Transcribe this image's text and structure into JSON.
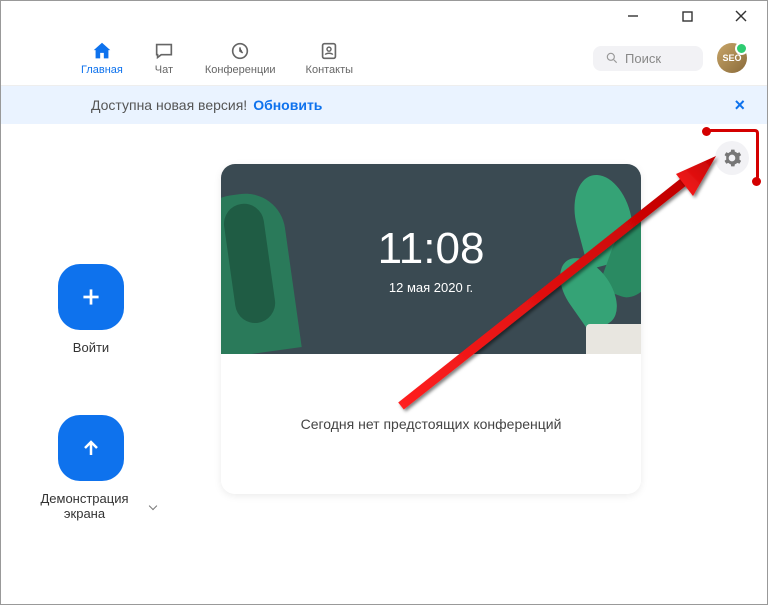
{
  "tabs": {
    "home": "Главная",
    "chat": "Чат",
    "meetings": "Конференции",
    "contacts": "Контакты"
  },
  "search": {
    "placeholder": "Поиск"
  },
  "banner": {
    "message": "Доступна новая версия!",
    "action": "Обновить"
  },
  "actions": {
    "join": "Войти",
    "share": "Демонстрация экрана"
  },
  "clock": {
    "time": "11:08",
    "date": "12 мая 2020 г."
  },
  "status": {
    "empty": "Сегодня нет предстоящих конференций"
  }
}
